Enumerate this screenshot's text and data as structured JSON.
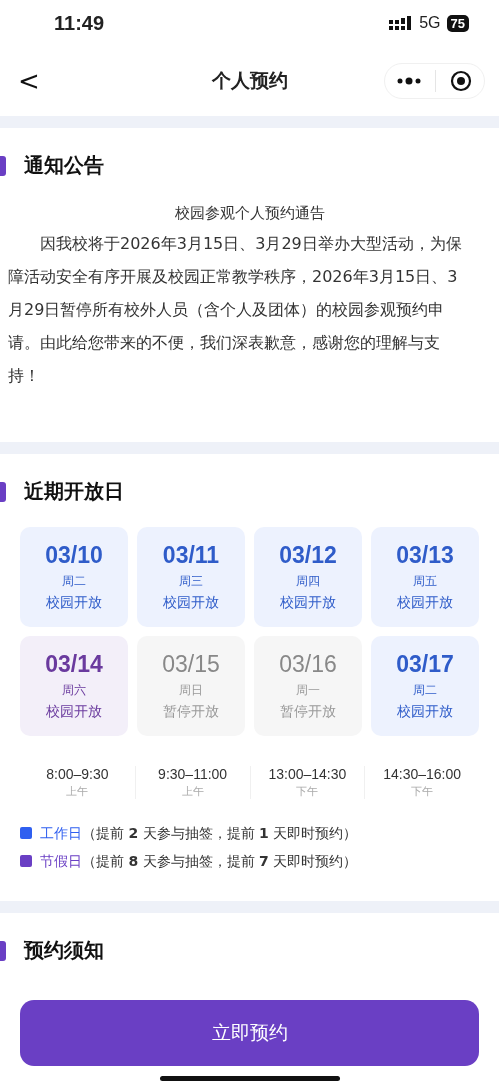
{
  "status_bar": {
    "time": "11:49",
    "network": "5G",
    "battery": "75"
  },
  "nav": {
    "title": "个人预约",
    "back": "<"
  },
  "notice": {
    "heading": "通知公告",
    "title": "校园参观个人预约通告",
    "body": "因我校将于2026年3月15日、3月29日举办大型活动，为保障活动安全有序开展及校园正常教学秩序，2026年3月15日、3月29日暂停所有校外人员（含个人及团体）的校园参观预约申请。由此给您带来的不便，我们深表歉意，感谢您的理解与支持！"
  },
  "open_days": {
    "heading": "近期开放日",
    "days": [
      {
        "date": "03/10",
        "weekday": "周二",
        "status": "校园开放",
        "kind": "workday"
      },
      {
        "date": "03/11",
        "weekday": "周三",
        "status": "校园开放",
        "kind": "workday"
      },
      {
        "date": "03/12",
        "weekday": "周四",
        "status": "校园开放",
        "kind": "workday"
      },
      {
        "date": "03/13",
        "weekday": "周五",
        "status": "校园开放",
        "kind": "workday"
      },
      {
        "date": "03/14",
        "weekday": "周六",
        "status": "校园开放",
        "kind": "holiday"
      },
      {
        "date": "03/15",
        "weekday": "周日",
        "status": "暂停开放",
        "kind": "closed"
      },
      {
        "date": "03/16",
        "weekday": "周一",
        "status": "暂停开放",
        "kind": "closed"
      },
      {
        "date": "03/17",
        "weekday": "周二",
        "status": "校园开放",
        "kind": "workday"
      }
    ],
    "slots": [
      {
        "time": "8:00–9:30",
        "period": "上午"
      },
      {
        "time": "9:30–11:00",
        "period": "上午"
      },
      {
        "time": "13:00–14:30",
        "period": "下午"
      },
      {
        "time": "14:30–16:00",
        "period": "下午"
      }
    ],
    "legend": [
      {
        "label": "工作日",
        "note": "（提前 **2** 天参与抽签，提前 **1** 天即时预约）",
        "color": "#2f5ff0"
      },
      {
        "label": "节假日",
        "note": "（提前 **8** 天参与抽签，提前 **7** 天即时预约）",
        "color": "#6a3fc4"
      }
    ]
  },
  "rules": {
    "heading": "预约须知"
  },
  "book_button": "立即预约"
}
